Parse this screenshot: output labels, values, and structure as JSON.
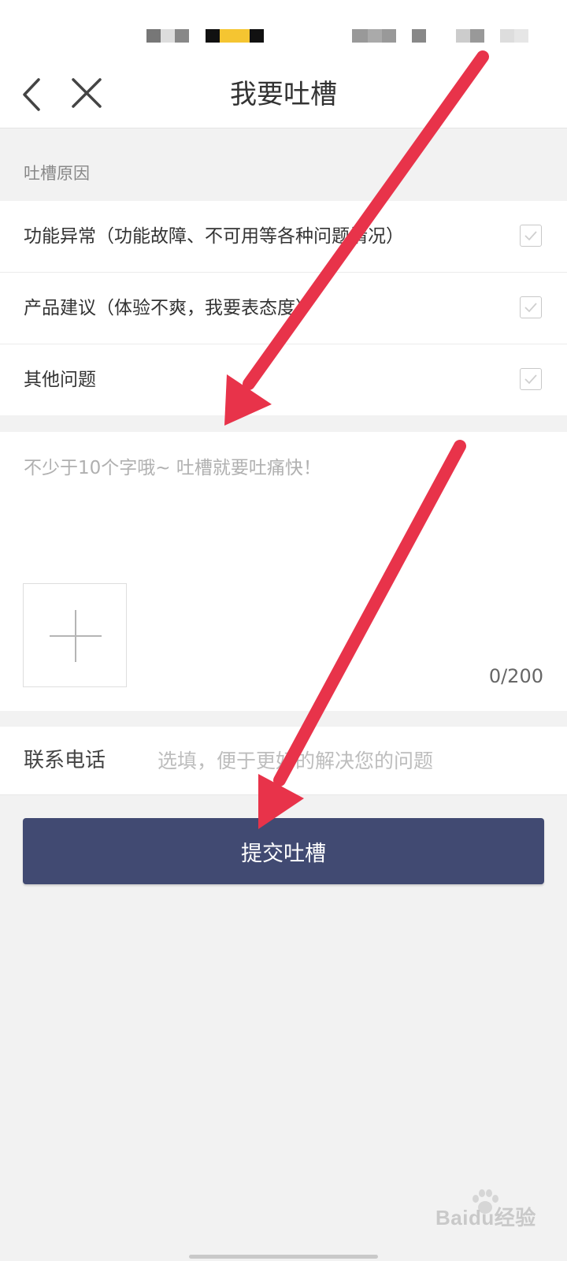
{
  "nav": {
    "title": "我要吐槽",
    "back_icon": "chevron-left-icon",
    "close_icon": "close-icon"
  },
  "reason_section": {
    "label": "吐槽原因",
    "items": [
      {
        "label": "功能异常（功能故障、不可用等各种问题情况）",
        "checked": false
      },
      {
        "label": "产品建议（体验不爽，我要表态度）",
        "checked": false
      },
      {
        "label": "其他问题",
        "checked": false
      }
    ]
  },
  "feedback": {
    "placeholder": "不少于10个字哦~ 吐槽就要吐痛快！",
    "value": "",
    "add_image_icon": "plus-icon",
    "char_count": "0/200"
  },
  "contact": {
    "label": "联系电话",
    "placeholder": "选填，便于更好的解决您的问题",
    "value": ""
  },
  "submit": {
    "label": "提交吐槽",
    "color": "#414a72"
  },
  "annotation": {
    "arrow_color": "#e8334a"
  },
  "watermark": {
    "text": "Baidu经验"
  }
}
